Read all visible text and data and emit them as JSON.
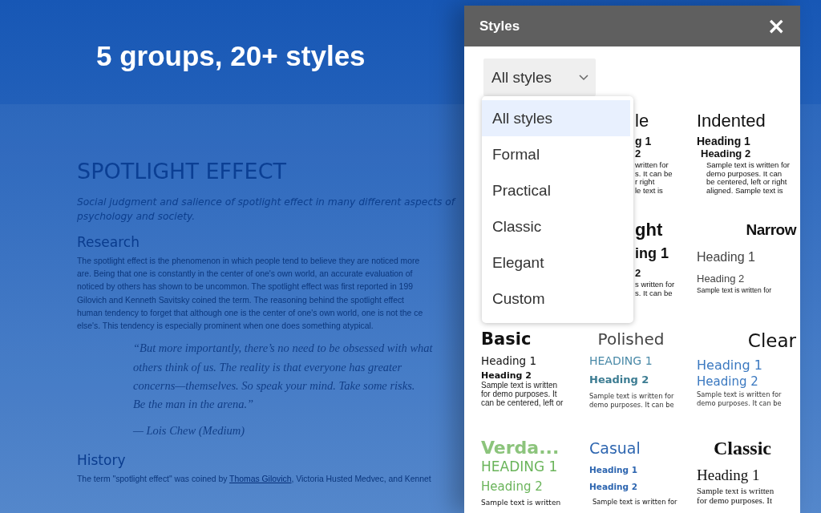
{
  "banner": {
    "title": "5 groups, 20+ styles"
  },
  "document": {
    "title": "SPOTLIGHT EFFECT",
    "subtitle": [
      "Social judgment and salience of spotlight effect in many different aspects of",
      "psychology and society."
    ],
    "sections": [
      {
        "heading": "Research",
        "lines": [
          "The spotlight effect is the phenomenon in which people tend to believe they are noticed more",
          "are. Being that one is constantly in the center of one's own world, an accurate evaluation of",
          "noticed by others has shown to be uncommon. The spotlight effect was first reported in 199",
          "Gilovich and Kenneth Savitsky coined the term. The reasoning behind the spotlight effect",
          "human tendency to forget that although one is the center of one's own world, one is not the ce",
          "else's. This tendency is especially prominent when one does something atypical."
        ]
      }
    ],
    "quote": {
      "lines": [
        "“But more importantly, there’s no need to be obsessed with what",
        "others think of us. The reality is that everyone has greater",
        "concerns—themselves. So speak your mind. Take some risks.",
        "Be the man in the arena.”"
      ],
      "source": "— Lois Chew (Medium)"
    },
    "history": {
      "heading": "History",
      "before": "The term \"spotlight effect\" was coined by ",
      "link": "Thomas Gilovich",
      "after": ", Victoria Husted Medvec, and Kennet"
    }
  },
  "panel": {
    "title": "Styles",
    "close": "×",
    "filter": {
      "value": "All styles",
      "expanded": true,
      "options": [
        {
          "label": "All styles",
          "selected": true
        },
        {
          "label": "Formal",
          "selected": false
        },
        {
          "label": "Practical",
          "selected": false
        },
        {
          "label": "Classic",
          "selected": false
        },
        {
          "label": "Elegant",
          "selected": false
        },
        {
          "label": "Custom",
          "selected": false
        }
      ]
    },
    "cards": [
      {
        "kind": "fragment",
        "title": "le",
        "heading_1": "g 1",
        "heading_2": "2",
        "sample": [
          "written for",
          "s. It can be",
          "r right",
          "le text is"
        ]
      },
      {
        "kind": "indented",
        "title": "Indented",
        "heading_1": "Heading 1",
        "heading_2": "Heading 2",
        "sample": [
          "Sample text is written for",
          "demo purposes. It can",
          "be centered, left or right",
          "aligned. Sample text is"
        ]
      },
      {
        "kind": "fragmentbold",
        "title": "ght",
        "heading_1": "ing 1",
        "heading_2": "2",
        "sample": [
          "s written for",
          "s. It can be"
        ]
      },
      {
        "kind": "narrow",
        "title": "Narrow",
        "heading_1": "Heading 1",
        "heading_2": "Heading 2",
        "sample": [
          "Sample text is written for"
        ]
      },
      {
        "kind": "basic",
        "title": "Basic",
        "heading_1": "Heading 1",
        "heading_2": "Heading 2",
        "sample": [
          "Sample text is written",
          "for demo purposes. It",
          "can be centered, left or"
        ]
      },
      {
        "kind": "polished",
        "title": "Polished",
        "heading_1": "HEADING 1",
        "heading_2": "Heading 2",
        "sample": [
          "Sample text is written for",
          "demo purposes. It can be"
        ]
      },
      {
        "kind": "clear",
        "title": "Clear",
        "heading_1": "Heading 1",
        "heading_2": "Heading 2",
        "sample": [
          "Sample text is written for",
          "demo purposes. It can be"
        ]
      },
      {
        "kind": "verdana",
        "title": "Verda...",
        "heading_1": "HEADING 1",
        "heading_2": "Heading 2",
        "sample": [
          "Sample text is written"
        ]
      },
      {
        "kind": "casual",
        "title": "Casual",
        "heading_1": "Heading 1",
        "heading_2": "Heading 2",
        "sample": [
          "Sample text is written for"
        ]
      },
      {
        "kind": "classic",
        "title": "Classic",
        "heading_1": "Heading 1",
        "sample": [
          "Sample text is written",
          "for demo purposes. It"
        ]
      }
    ]
  }
}
